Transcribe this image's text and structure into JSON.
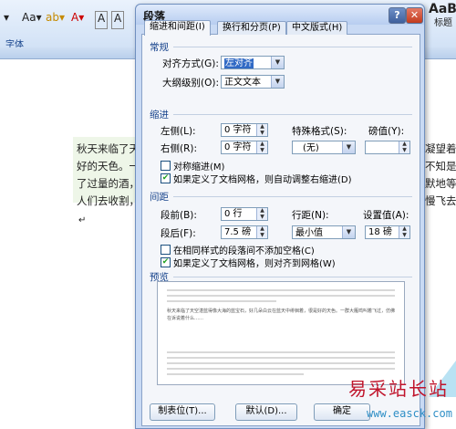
{
  "word": {
    "font_group_label": "字体",
    "ribbon_top_right": "标题",
    "ribbon_top_right_label": "AaB",
    "doc_lines": [
      "秋天来临了天空",
      "好的天色。一群",
      "了过量的酒，纷",
      "人们去收割，当"
    ],
    "doc_right_lines": [
      "凝望着",
      "不知是",
      "默地等",
      "慢飞去"
    ],
    "enter_mark": "↵"
  },
  "dialog": {
    "title": "段落",
    "help_label": "?",
    "close_label": "✕",
    "tabs": [
      {
        "label": "缩进和间距(I)"
      },
      {
        "label": "换行和分页(P)"
      },
      {
        "label": "中文版式(H)"
      }
    ],
    "general": {
      "title": "常规",
      "alignment_label": "对齐方式(G):",
      "alignment_value": "左对齐",
      "outline_label": "大纲级别(O):",
      "outline_value": "正文文本"
    },
    "indent": {
      "title": "缩进",
      "left_label": "左侧(L):",
      "left_value": "0 字符",
      "right_label": "右侧(R):",
      "right_value": "0 字符",
      "special_label": "特殊格式(S):",
      "special_value": "(无)",
      "measure_label": "磅值(Y):",
      "measure_value": "",
      "mirror_label": "对称缩进(M)",
      "mirror_checked": false,
      "grid_indent_label": "如果定义了文档网格，则自动调整右缩进(D)",
      "grid_indent_checked": true
    },
    "spacing": {
      "title": "间距",
      "before_label": "段前(B):",
      "before_value": "0 行",
      "after_label": "段后(F):",
      "after_value": "7.5 磅",
      "line_label": "行距(N):",
      "line_value": "最小值",
      "at_label": "设置值(A):",
      "at_value": "18 磅",
      "no_space_label": "在相同样式的段落间不添加空格(C)",
      "no_space_checked": false,
      "snap_grid_label": "如果定义了文档网格，则对齐到网格(W)",
      "snap_grid_checked": true
    },
    "preview": {
      "title": "预览",
      "sample_text": "秋天来临了天空湛蓝得像大海的蓝宝石，好几朵白云在蓝天中绯徊着，很是好的天色。一群大雁鸣叫着飞过，仿佛在诉说着什么……"
    },
    "buttons": {
      "tabs_label": "制表位(T)...",
      "default_label": "默认(D)...",
      "ok_label": "确定"
    }
  },
  "watermark": {
    "text": "易采站长站",
    "url": "www.easck.com"
  }
}
